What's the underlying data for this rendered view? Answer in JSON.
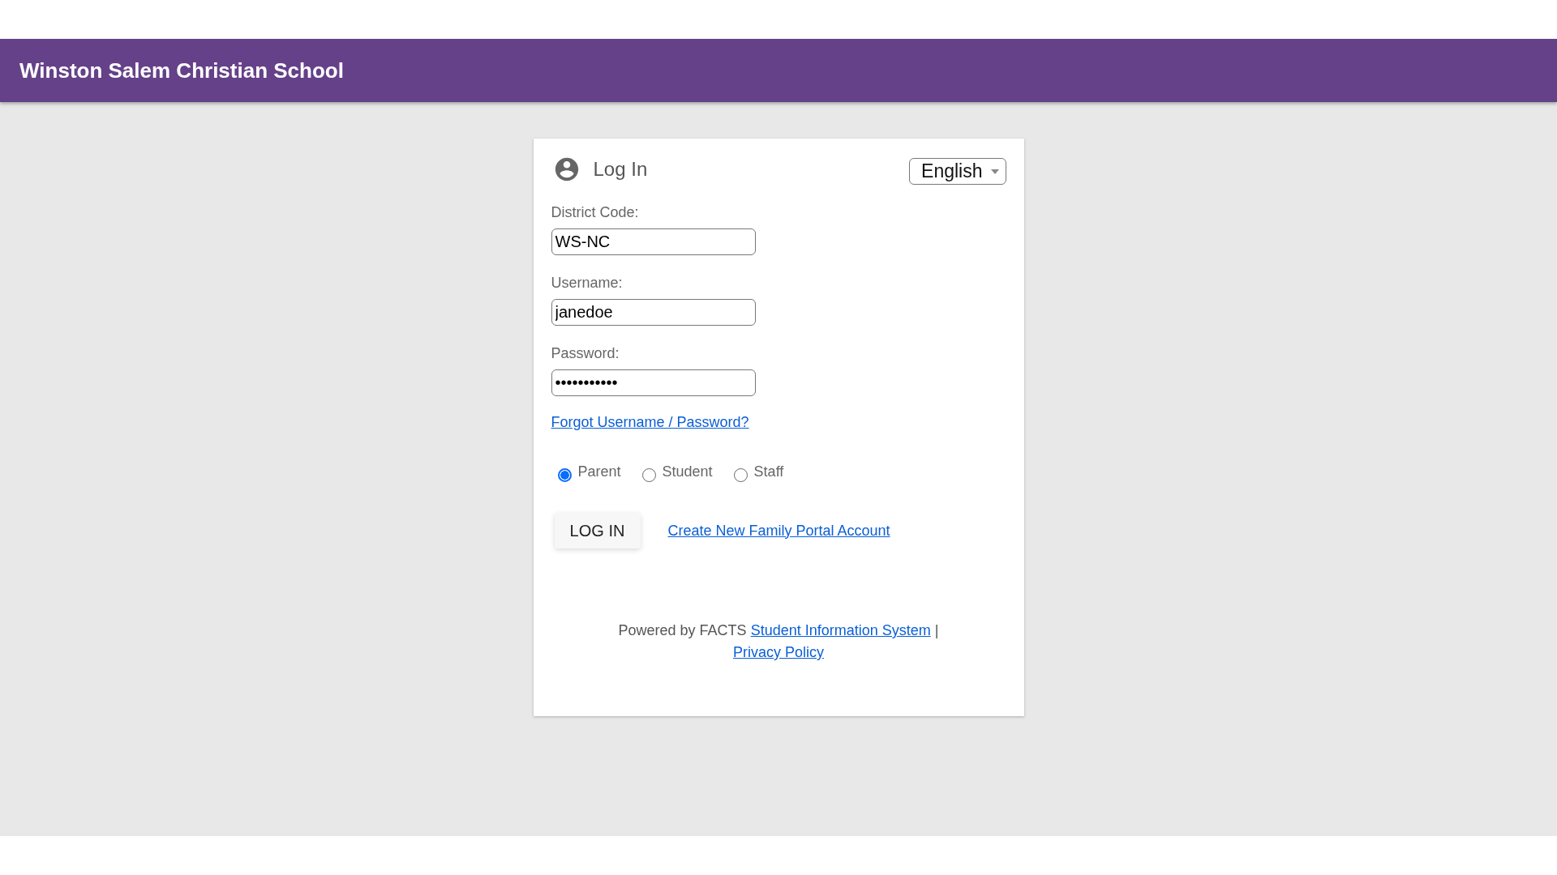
{
  "header": {
    "title": "Winston Salem Christian School"
  },
  "login_card": {
    "title": "Log In",
    "language": "English",
    "fields": [
      {
        "label": "District Code:",
        "value": "WS-NC"
      },
      {
        "label": "Username:",
        "value": "janedoe"
      },
      {
        "label": "Password:",
        "value": "•••••••••••"
      }
    ],
    "forgot_link": "Forgot Username / Password?",
    "roles": [
      {
        "label": "Parent",
        "selected": true
      },
      {
        "label": "Student",
        "selected": false
      },
      {
        "label": "Staff",
        "selected": false
      }
    ],
    "login_button": "LOG IN",
    "create_account_link": "Create New Family Portal Account",
    "footer": {
      "text": "Powered by FACTS",
      "sis_link": "Student Information System",
      "separator": "|",
      "privacy_link": "Privacy Policy"
    }
  }
}
